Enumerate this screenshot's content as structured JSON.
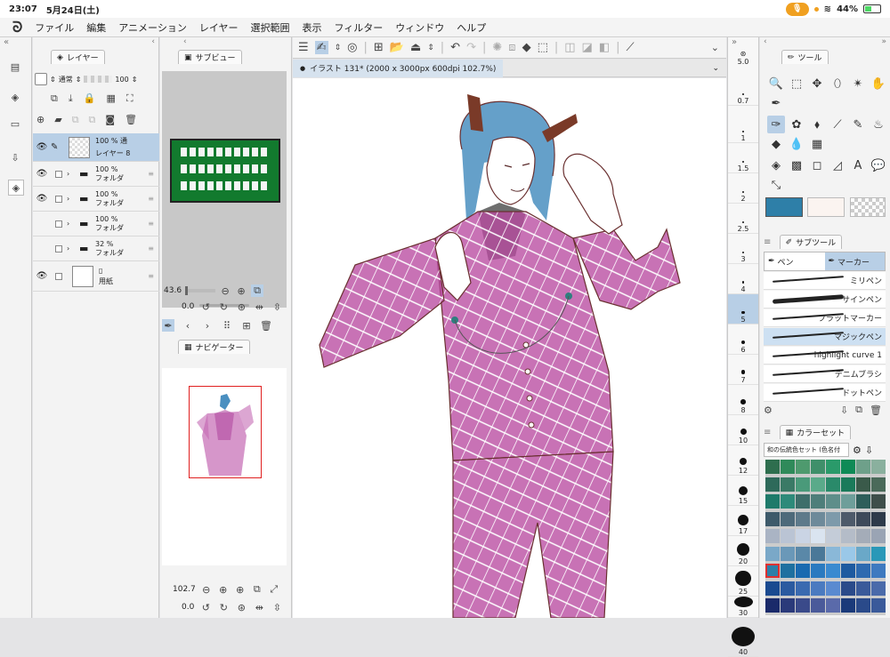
{
  "status": {
    "time": "23:07",
    "date": "5月24日(土)",
    "battery": "44%"
  },
  "menu": [
    "ファイル",
    "編集",
    "アニメーション",
    "レイヤー",
    "選択範囲",
    "表示",
    "フィルター",
    "ウィンドウ",
    "ヘルプ"
  ],
  "layer_panel": {
    "title": "レイヤー",
    "blend": "通常",
    "opacity": "100",
    "layers": [
      {
        "pct": "100 %",
        "mode": "通",
        "name": "レイヤー 8",
        "selected": true
      },
      {
        "pct": "100 %",
        "name": "フォルダ"
      },
      {
        "pct": "100 %",
        "name": "フォルダ"
      },
      {
        "pct": "100 %",
        "name": "フォルダ"
      },
      {
        "pct": "32 %",
        "name": "フォルダ"
      },
      {
        "pct": "",
        "name": "用紙"
      }
    ]
  },
  "subview": {
    "title": "サブビュー",
    "zoom": "43.6",
    "rotate": "0.0"
  },
  "navigator": {
    "title": "ナビゲーター",
    "zoom": "102.7",
    "rotate": "0.0"
  },
  "canvas": {
    "tab": "イラスト 131* (2000 x 3000px 600dpi 102.7%)"
  },
  "brush_sizes": [
    "5.0",
    "0.7",
    "1",
    "1.5",
    "2",
    "2.5",
    "3",
    "4",
    "5",
    "6",
    "7",
    "8",
    "10",
    "12",
    "15",
    "17",
    "20",
    "25",
    "30",
    "40"
  ],
  "tool_panel": {
    "title": "ツール"
  },
  "subtool": {
    "title": "サブツール",
    "tab1": "ペン",
    "tab2": "マーカー",
    "brushes": [
      "ミリペン",
      "サインペン",
      "フラットマーカー",
      "マジックペン",
      "highlight curve 1",
      "デニムブラシ",
      "ドットペン"
    ]
  },
  "colorset": {
    "title": "カラーセット",
    "name": "和の伝統色セット (色名付"
  },
  "colors": {
    "accent": "#b8cfe6",
    "main_color": "#2e7fa8",
    "sub_color": "#fbf4f0",
    "suit": "#b84aa0"
  },
  "swatches": [
    "#2e6e4e",
    "#2f8a5a",
    "#4e9a6e",
    "#3f8f6a",
    "#2a9a6a",
    "#0e8a56",
    "#6ea08a",
    "#8ab09e",
    "#2e6a5a",
    "#3a7a66",
    "#4a9a7a",
    "#5aaa8a",
    "#2a8a6a",
    "#1a7a5a",
    "#3a5a4a",
    "#4a6a5a",
    "#1e7a6a",
    "#2e8a7a",
    "#3e6e6a",
    "#4e7e7a",
    "#5e8e8a",
    "#6e9e9a",
    "#2e5e5a",
    "#3e4e4a",
    "#3e5a6a",
    "#4e6a7a",
    "#5e7a8a",
    "#6e8a9a",
    "#7e9aaa",
    "#4e5a6a",
    "#3e4a5a",
    "#2e3a4a",
    "#aab4c4",
    "#bac4d4",
    "#cad4e4",
    "#dae4f0",
    "#c4ccd8",
    "#b4bcc8",
    "#a4acb8",
    "#9aa4b4",
    "#7aa8c8",
    "#6a98b8",
    "#5a88a8",
    "#4a7898",
    "#8ab8d8",
    "#9ac8e8",
    "#6aa8c8",
    "#2a98b8",
    "#2e7fa8",
    "#1e70a0",
    "#1a6ab0",
    "#2a7ac0",
    "#3a8ad0",
    "#1e5aa0",
    "#2e6ab0",
    "#3e7ac0",
    "#1a4a90",
    "#2a5aa0",
    "#3a6ab0",
    "#4a7ac0",
    "#5a8ad0",
    "#2a4a8a",
    "#3a5a9a",
    "#4a6aaa",
    "#1a2a6a",
    "#2a3a7a",
    "#3a4a8a",
    "#4a5a9a",
    "#5a6aaa",
    "#1a3a7a",
    "#2a4a8a",
    "#3a5a9a"
  ]
}
